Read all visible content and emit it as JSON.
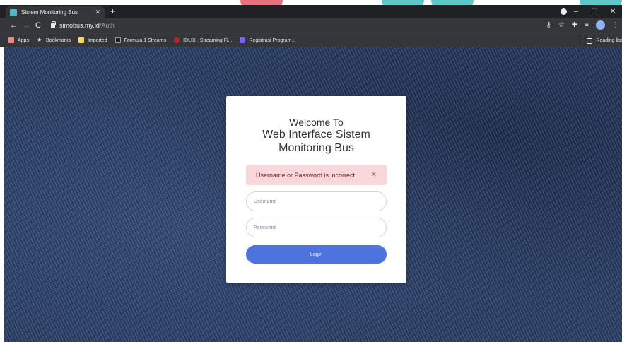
{
  "browser": {
    "tab": {
      "title": "Sistem Monitoring Bus",
      "favicon": "page-favicon-icon"
    },
    "url": {
      "host": "simobus.my.id",
      "path": "/Auth"
    },
    "bookmarks": [
      {
        "label": "Apps",
        "icon": "apps-grid-icon",
        "color": "#f28b82"
      },
      {
        "label": "Bookmarks",
        "icon": "star-icon",
        "color": "#e8eaed"
      },
      {
        "label": "Imported",
        "icon": "folder-icon",
        "color": "#fdd663"
      },
      {
        "label": "Formula 1 Streams",
        "icon": "f1-icon",
        "color": "#202124"
      },
      {
        "label": "IDLIX - Streaming Fi...",
        "icon": "idlix-icon",
        "color": "#c5221f"
      },
      {
        "label": "Registrasi Program...",
        "icon": "registrasi-icon",
        "color": "#7b61ff"
      }
    ],
    "reading_list": "Reading list"
  },
  "login": {
    "welcome": "Welcome To",
    "title_line1": "Web Interface Sistem",
    "title_line2": "Monitoring Bus",
    "alert": "Username or Password is incorrect",
    "username_placeholder": "Username",
    "password_placeholder": "Password",
    "login_label": "Login"
  },
  "colors": {
    "primary": "#4e73df",
    "alert_bg": "#f8d7da",
    "alert_text": "#721c24"
  }
}
